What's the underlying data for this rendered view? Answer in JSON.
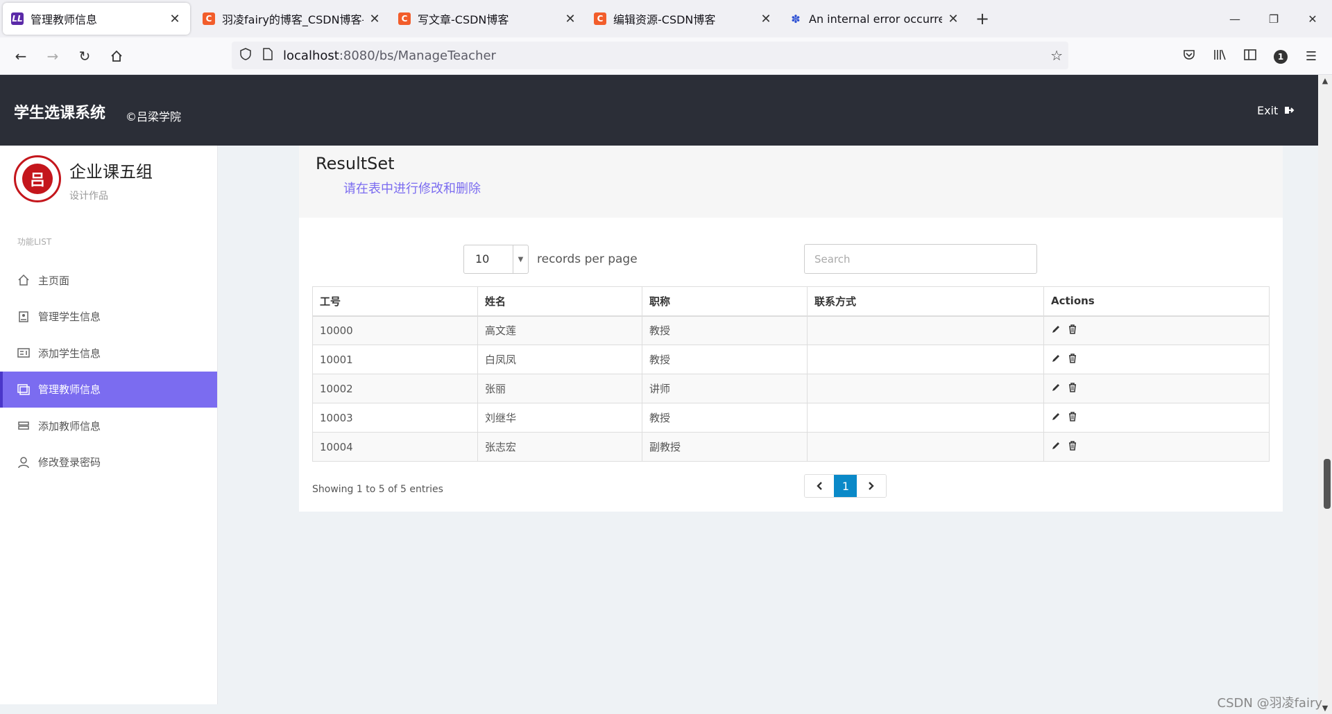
{
  "browser": {
    "tabs": [
      {
        "title": "管理教师信息",
        "favicon": "LL",
        "active": true
      },
      {
        "title": "羽凌fairy的博客_CSDN博客-计",
        "favicon": "C",
        "active": false
      },
      {
        "title": "写文章-CSDN博客",
        "favicon": "C",
        "active": false
      },
      {
        "title": "编辑资源-CSDN博客",
        "favicon": "C",
        "active": false
      },
      {
        "title": "An internal error occurred du",
        "favicon": "paw",
        "active": false
      }
    ],
    "url_host": "localhost",
    "url_rest": ":8080/bs/ManageTeacher",
    "notification_count": "1"
  },
  "header": {
    "app_title": "学生选课系统",
    "copyright": "©吕梁学院",
    "exit_label": "Exit"
  },
  "sidebar": {
    "logo_text": "吕",
    "org_name": "企业课五组",
    "org_sub": "设计作品",
    "menu_heading": "功能LIST",
    "items": [
      {
        "label": "主页面",
        "icon": "home-icon"
      },
      {
        "label": "管理学生信息",
        "icon": "student-icon"
      },
      {
        "label": "添加学生信息",
        "icon": "add-card-icon"
      },
      {
        "label": "管理教师信息",
        "icon": "teacher-icon",
        "active": true
      },
      {
        "label": "添加教师信息",
        "icon": "stack-icon"
      },
      {
        "label": "修改登录密码",
        "icon": "user-icon"
      }
    ]
  },
  "main": {
    "title": "ResultSet",
    "subtitle": "请在表中进行修改和删除",
    "page_length": "10",
    "length_label": "records per page",
    "search_placeholder": "Search",
    "columns": [
      "工号",
      "姓名",
      "职称",
      "联系方式",
      "Actions"
    ],
    "rows": [
      [
        "10000",
        "高文莲",
        "教授",
        ""
      ],
      [
        "10001",
        "白凤凤",
        "教授",
        ""
      ],
      [
        "10002",
        "张丽",
        "讲师",
        ""
      ],
      [
        "10003",
        "刘继华",
        "教授",
        ""
      ],
      [
        "10004",
        "张志宏",
        "副教授",
        ""
      ]
    ],
    "info": "Showing 1 to 5 of 5 entries",
    "current_page": "1"
  },
  "watermark": "CSDN @羽凌fairy"
}
